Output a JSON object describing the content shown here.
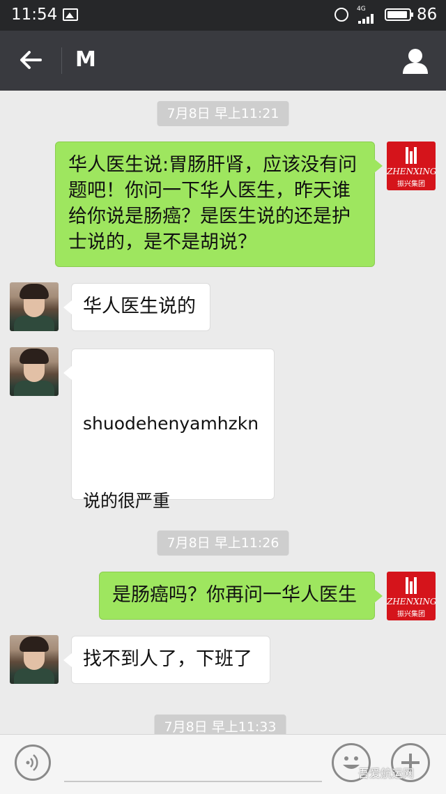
{
  "status_bar": {
    "time": "11:54",
    "network": "4G",
    "battery": "86"
  },
  "header": {
    "title": "M"
  },
  "messages": [
    {
      "type": "timestamp",
      "text": "7月8日 早上11:21"
    },
    {
      "type": "sent",
      "text": "华人医生说:胃肠肝肾，应该没有问题吧！你问一下华人医生，昨天谁给你说是肠癌？是医生说的还是护士说的，是不是胡说？"
    },
    {
      "type": "received",
      "text": "华人医生说的"
    },
    {
      "type": "received",
      "text": "shuodehenyamhzkn\n\n\n说的很严重"
    },
    {
      "type": "timestamp",
      "text": "7月8日 早上11:26"
    },
    {
      "type": "sent",
      "text": "是肠癌吗？你再问一华人医生"
    },
    {
      "type": "received",
      "text": "找不到人了，下班了"
    },
    {
      "type": "timestamp",
      "text": "7月8日 早上11:33"
    }
  ],
  "sender_avatar": {
    "brand": "ZHENXING",
    "subtitle": "振兴集团",
    "color": "#d5141b"
  },
  "colors": {
    "sent_bubble": "#9ee65f",
    "received_bubble": "#ffffff",
    "header_bg": "#393a3f",
    "chat_bg": "#ebebeb"
  },
  "watermark": "吾爱航运网"
}
